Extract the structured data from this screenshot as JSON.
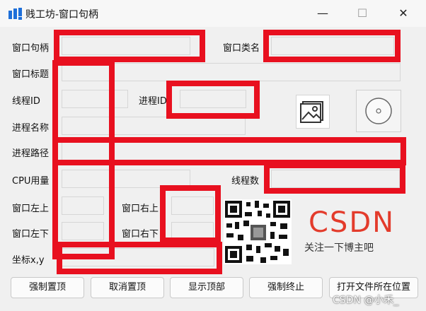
{
  "window": {
    "title": "贱工坊-窗口句柄",
    "controls": {
      "minimize": "—",
      "maximize": "☐",
      "close": "✕"
    }
  },
  "form": {
    "hwnd_label": "窗口句柄",
    "class_label": "窗口类名",
    "title_label": "窗口标题",
    "thread_id_label": "线程ID",
    "process_id_label": "进程ID",
    "process_name_label": "进程名称",
    "process_path_label": "进程路径",
    "cpu_label": "CPU用量",
    "thread_count_label": "线程数",
    "win_topleft_label": "窗口左上",
    "win_topright_label": "窗口右上",
    "win_bottomleft_label": "窗口左下",
    "win_bottomright_label": "窗口右下",
    "coord_label": "坐标x,y"
  },
  "buttons": {
    "force_top": "强制置顶",
    "cancel_top": "取消置顶",
    "show_top": "显示顶部",
    "force_terminate": "强制终止",
    "open_location": "打开文件所在位置"
  },
  "promo": {
    "logo": "CSDN",
    "follow_text": "关注一下博主吧"
  },
  "watermark": "CSDN @小禾_",
  "colors": {
    "highlight": "#e8101f",
    "csdn": "#e33b2b",
    "icon_blue": "#1e6fd9"
  }
}
